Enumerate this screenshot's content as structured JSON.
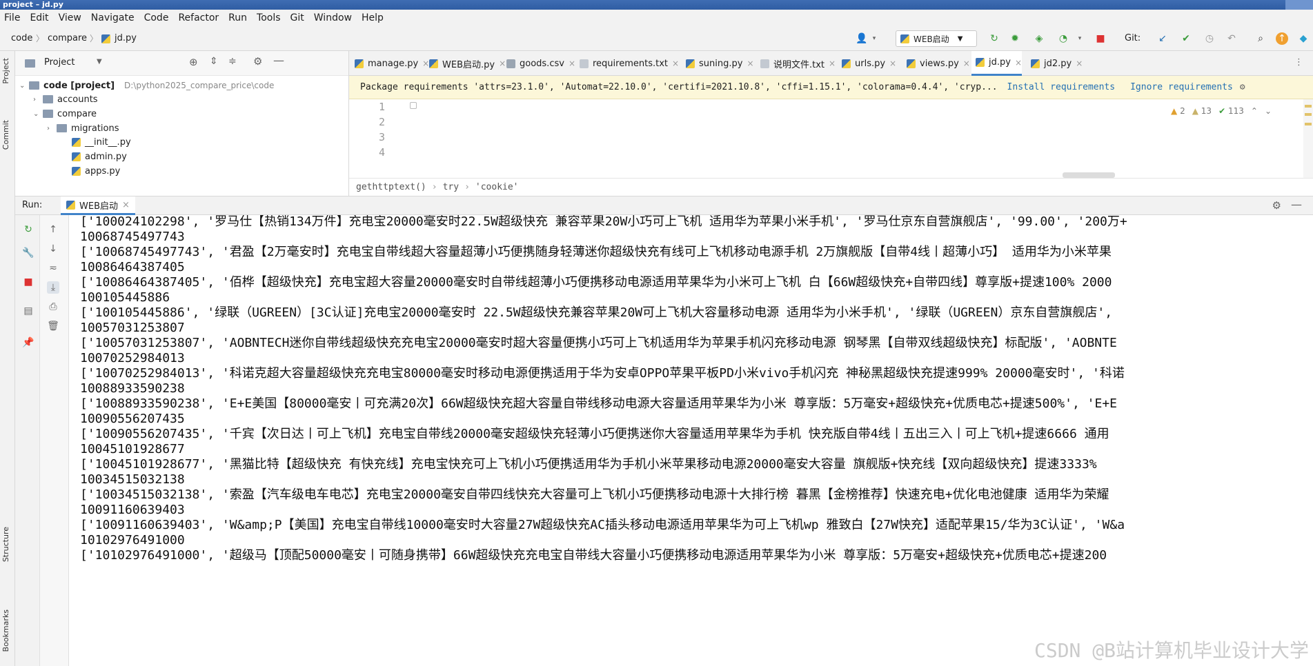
{
  "window": {
    "title": "project – jd.py"
  },
  "menu": [
    "File",
    "Edit",
    "View",
    "Navigate",
    "Code",
    "Refactor",
    "Run",
    "Tools",
    "Git",
    "Window",
    "Help"
  ],
  "nav": {
    "breadcrumbs": [
      "code",
      "compare",
      "jd.py"
    ],
    "run_config": "WEB启动",
    "git_label": "Git:"
  },
  "project_panel": {
    "title": "Project",
    "tree": [
      {
        "label": "code [project]",
        "path": "D:\\python2025_compare_price\\code",
        "type": "folder",
        "level": 0,
        "expanded": true
      },
      {
        "label": "accounts",
        "type": "folder",
        "level": 1,
        "expanded": false
      },
      {
        "label": "compare",
        "type": "folder",
        "level": 1,
        "expanded": true
      },
      {
        "label": "migrations",
        "type": "folder",
        "level": 2,
        "expanded": false
      },
      {
        "label": "__init__.py",
        "type": "py",
        "level": 2
      },
      {
        "label": "admin.py",
        "type": "py",
        "level": 2
      },
      {
        "label": "apps.py",
        "type": "py",
        "level": 2
      }
    ]
  },
  "editor": {
    "tabs": [
      {
        "label": "manage.py",
        "active": false
      },
      {
        "label": "WEB启动.py",
        "active": false
      },
      {
        "label": "goods.csv",
        "active": false
      },
      {
        "label": "requirements.txt",
        "active": false
      },
      {
        "label": "suning.py",
        "active": false
      },
      {
        "label": "说明文件.txt",
        "active": false
      },
      {
        "label": "urls.py",
        "active": false
      },
      {
        "label": "views.py",
        "active": false
      },
      {
        "label": "jd.py",
        "active": true
      },
      {
        "label": "jd2.py",
        "active": false
      }
    ],
    "banner": {
      "text": "Package requirements 'attrs=23.1.0', 'Automat=22.10.0', 'certifi=2021.10.8', 'cffi=1.15.1', 'colorama=0.4.4', 'cryp...",
      "install": "Install requirements",
      "ignore": "Ignore requirements"
    },
    "inspections": {
      "warnings": "2",
      "weak_warnings": "13",
      "typos": "113"
    },
    "line_numbers": [
      "1",
      "2",
      "3",
      "4"
    ],
    "breadcrumb": [
      "gethttptext()",
      "try",
      "'cookie'"
    ]
  },
  "run_panel": {
    "label": "Run:",
    "tab": "WEB启动",
    "lines": [
      "['100024102298', '罗马仕【热销134万件】充电宝20000毫安时22.5W超级快充 兼容苹果20W小巧可上飞机 适用华为苹果小米手机', '罗马仕京东自营旗舰店', '99.00', '200万+",
      "10068745497743",
      "['10068745497743', '君盈【2万毫安时】充电宝自带线超大容量超薄小巧便携随身轻薄迷你超级快充有线可上飞机移动电源手机 2万旗舰版【自带4线丨超薄小巧】 适用华为小米苹果",
      "10086464387405",
      "['10086464387405', '佰桦【超级快充】充电宝超大容量20000毫安时自带线超薄小巧便携移动电源适用苹果华为小米可上飞机 白【66W超级快充+自带四线】尊享版+提速100% 2000",
      "100105445886",
      "['100105445886', '绿联（UGREEN）[3C认证]充电宝20000毫安时 22.5W超级快充兼容苹果20W可上飞机大容量移动电源 适用华为小米手机', '绿联（UGREEN）京东自营旗舰店',",
      "10057031253807",
      "['10057031253807', 'AOBNTECH迷你自带线超级快充充电宝20000毫安时超大容量便携小巧可上飞机适用华为苹果手机闪充移动电源 钢琴黑【自带双线超级快充】标配版', 'AOBNTE",
      "10070252984013",
      "['10070252984013', '科诺克超大容量超级快充充电宝80000毫安时移动电源便携适用于华为安卓OPPO苹果平板PD小米vivo手机闪充 神秘黑超级快充提速999% 20000毫安时', '科诺",
      "10088933590238",
      "['10088933590238', 'E+E美国【80000毫安丨可充满20次】66W超级快充超大容量自带线移动电源大容量适用苹果华为小米 尊享版：5万毫安+超级快充+优质电芯+提速500%', 'E+E",
      "10090556207435",
      "['10090556207435', '千宾【次日达丨可上飞机】充电宝自带线20000毫安超级快充轻薄小巧便携迷你大容量适用苹果华为手机 快充版自带4线丨五出三入丨可上飞机+提速6666 通用",
      "10045101928677",
      "['10045101928677', '黑猫比特【超级快充 有快充线】充电宝快充可上飞机小巧便携适用华为手机小米苹果移动电源20000毫安大容量 旗舰版+快充线【双向超级快充】提速3333% ",
      "10034515032138",
      "['10034515032138', '索盈【汽车级电车电芯】充电宝20000毫安自带四线快充大容量可上飞机小巧便携移动电源十大排行榜 暮黑【金榜推荐】快速充电+优化电池健康 适用华为荣耀",
      "10091160639403",
      "['10091160639403', 'W&amp;P【美国】充电宝自带线10000毫安时大容量27W超级快充AC插头移动电源适用苹果华为可上飞机wp 雅致白【27W快充】适配苹果15/华为3C认证', 'W&a",
      "10102976491000",
      "['10102976491000', '超级马【顶配50000毫安丨可随身携带】66W超级快充充电宝自带线大容量小巧便携移动电源适用苹果华为小米 尊享版：5万毫安+超级快充+优质电芯+提速200"
    ]
  },
  "watermark": "CSDN @B站计算机毕业设计大学",
  "colors": {
    "accent": "#4083c9",
    "banner_bg": "#fcf7d9",
    "link": "#2470b3"
  }
}
